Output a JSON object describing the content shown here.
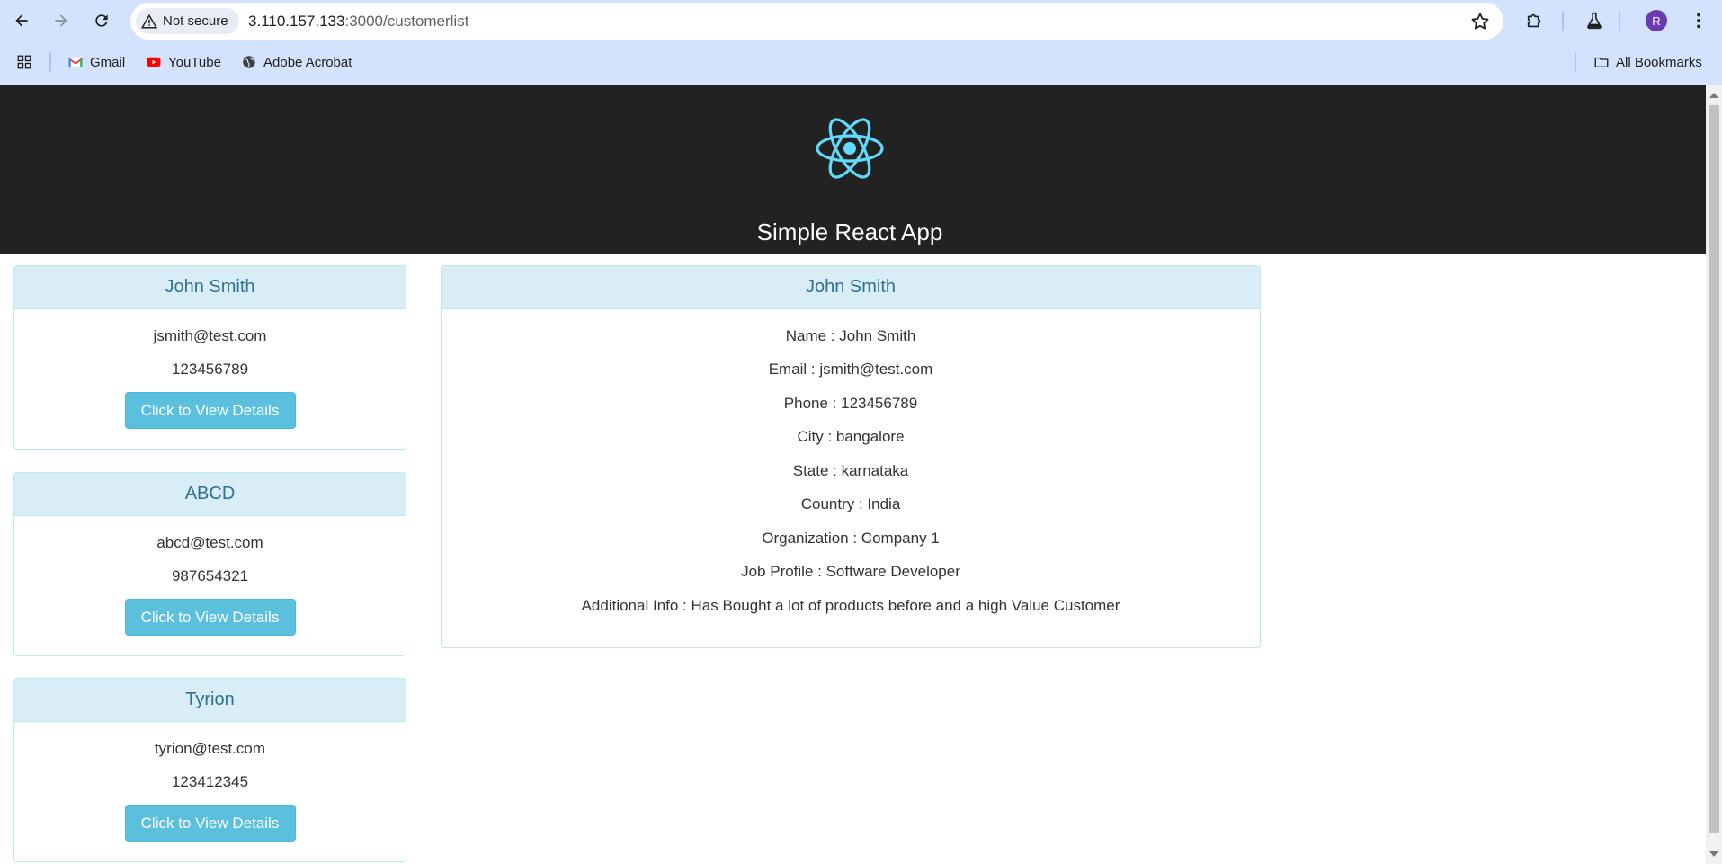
{
  "browser": {
    "security_label": "Not secure",
    "url_host": "3.110.157.133",
    "url_path": ":3000/customerlist",
    "bookmarks": [
      {
        "label": "Gmail",
        "icon": "gmail-icon"
      },
      {
        "label": "YouTube",
        "icon": "youtube-icon"
      },
      {
        "label": "Adobe Acrobat",
        "icon": "globe-icon"
      }
    ],
    "all_bookmarks_label": "All Bookmarks",
    "profile_initial": "R",
    "colors": {
      "toolbar": "#d3e3fd",
      "avatar": "#6a3ab2"
    }
  },
  "app": {
    "title": "Simple React App",
    "logo_icon": "react-atom-icon",
    "colors": {
      "header_bg": "#222222",
      "logo": "#61dafb",
      "panel_heading_bg": "#d9edf7",
      "panel_heading_text": "#31708f",
      "button": "#5bc0de"
    }
  },
  "customers": [
    {
      "name": "John Smith",
      "email": "jsmith@test.com",
      "phone": "123456789",
      "button_label": "Click to View Details"
    },
    {
      "name": "ABCD",
      "email": "abcd@test.com",
      "phone": "987654321",
      "button_label": "Click to View Details"
    },
    {
      "name": "Tyrion",
      "email": "tyrion@test.com",
      "phone": "123412345",
      "button_label": "Click to View Details"
    }
  ],
  "details": {
    "heading": "John Smith",
    "lines": [
      "Name : John Smith",
      "Email : jsmith@test.com",
      "Phone : 123456789",
      "City : bangalore",
      "State : karnataka",
      "Country : India",
      "Organization : Company 1",
      "Job Profile : Software Developer",
      "Additional Info : Has Bought a lot of products before and a high Value Customer"
    ]
  }
}
